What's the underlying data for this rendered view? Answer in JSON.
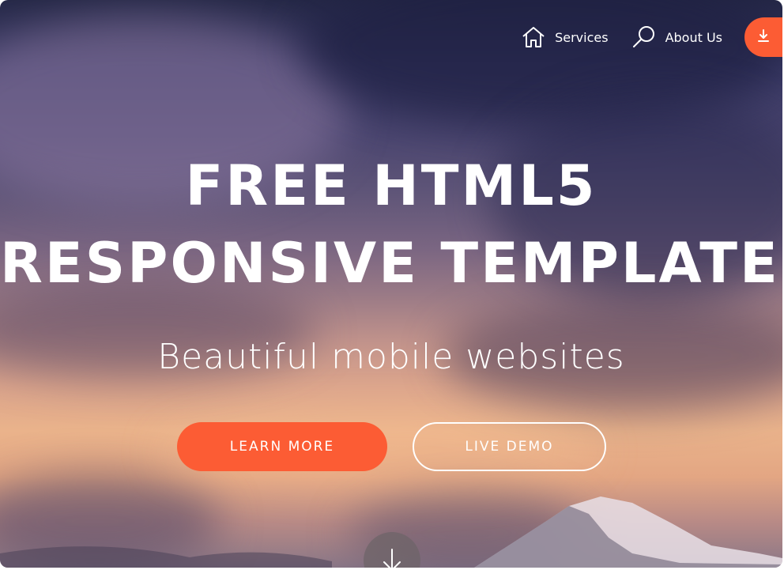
{
  "nav": {
    "items": [
      {
        "label": "Services",
        "icon": "home-icon"
      },
      {
        "label": "About Us",
        "icon": "search-icon"
      }
    ],
    "cta_icon": "download-icon"
  },
  "hero": {
    "title_line1": "FREE HTML5",
    "title_line2": "RESPONSIVE TEMPLATES",
    "subtitle": "Beautiful mobile websites",
    "primary_button": "LEARN MORE",
    "secondary_button": "LIVE DEMO",
    "scroll_icon": "arrow-down-icon"
  },
  "colors": {
    "accent": "#fc5c34",
    "text": "#ffffff"
  }
}
